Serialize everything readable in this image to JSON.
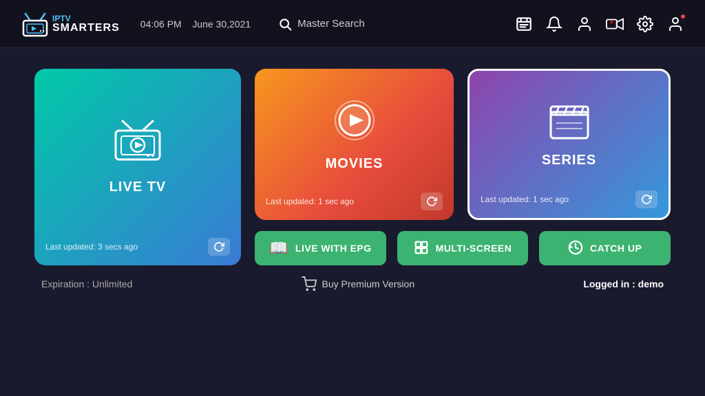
{
  "header": {
    "logo_text_iptv": "IPTV",
    "logo_text_smarters": "SMARTERS",
    "time": "04:06 PM",
    "date": "June 30,2021",
    "search_label": "Master Search"
  },
  "cards": {
    "live_tv": {
      "title": "LIVE TV",
      "last_updated": "Last updated: 3 secs ago"
    },
    "movies": {
      "title": "MOVIES",
      "last_updated": "Last updated: 1 sec ago"
    },
    "series": {
      "title": "SERIES",
      "last_updated": "Last updated: 1 sec ago"
    }
  },
  "buttons": {
    "live_epg": "LIVE WITH\nEPG",
    "live_epg_display": "LIVE WITH EPG",
    "multi_screen": "MULTI-SCREEN",
    "catch_up": "CATCH UP"
  },
  "footer": {
    "expiration": "Expiration : Unlimited",
    "buy_premium": "Buy Premium Version",
    "logged_in_label": "Logged in : ",
    "logged_in_user": "demo"
  }
}
